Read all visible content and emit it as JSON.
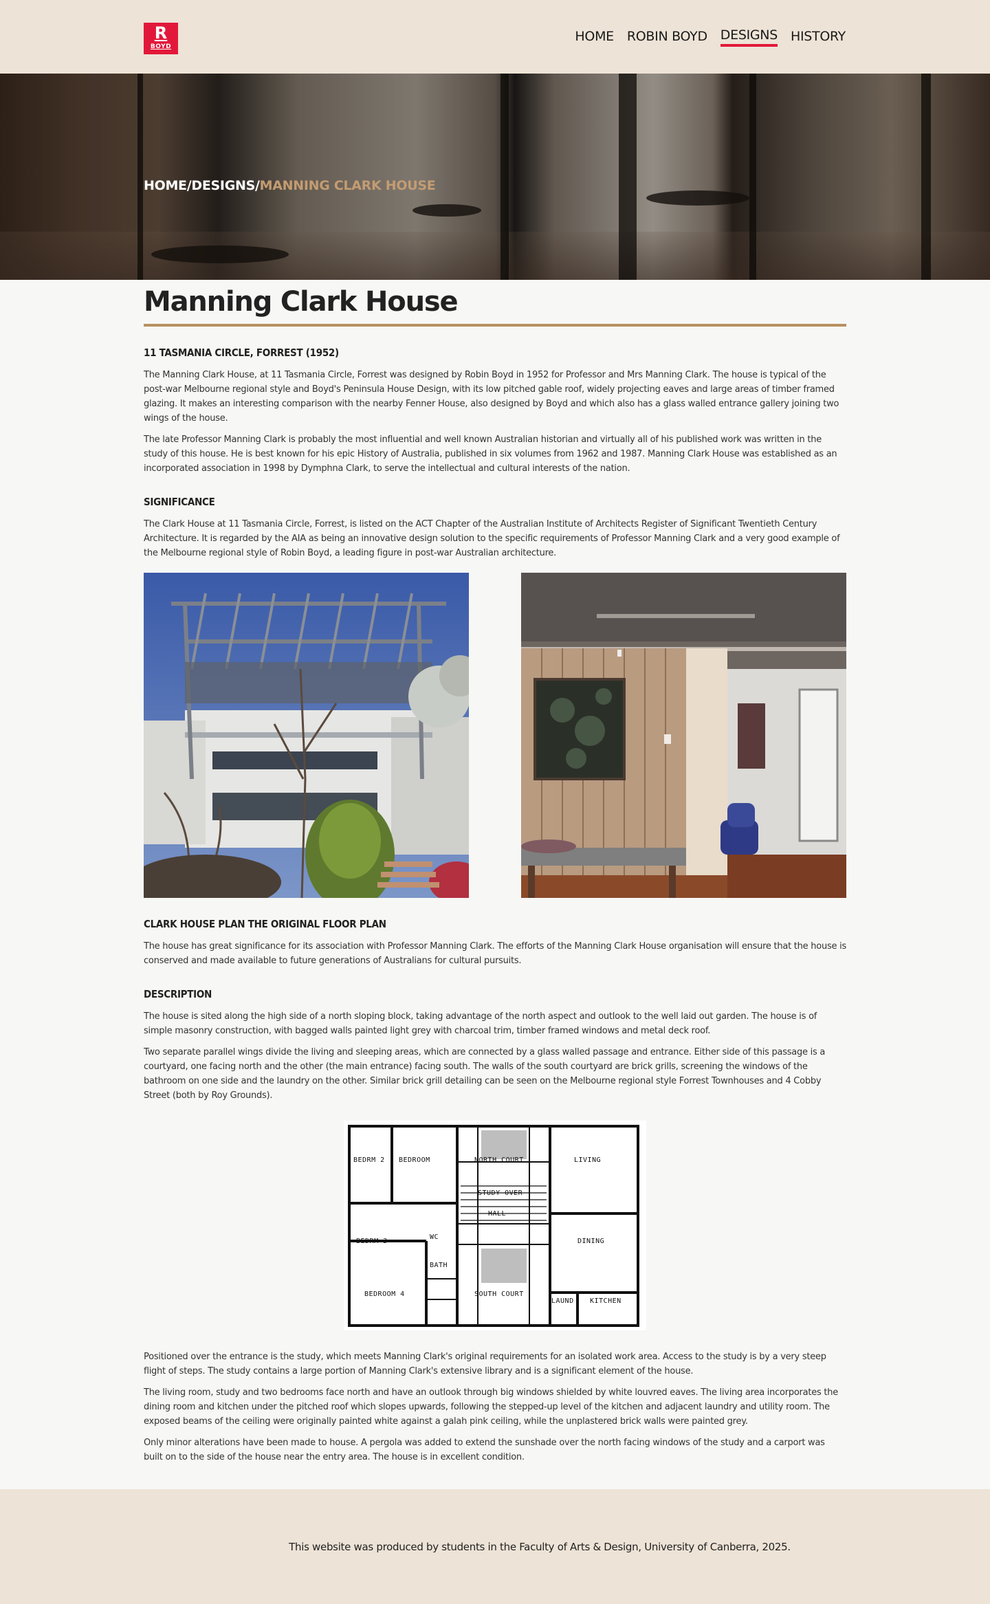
{
  "header": {
    "logo": {
      "letter": "R",
      "sub": "BOYD"
    },
    "nav": [
      {
        "label": "HOME"
      },
      {
        "label": "ROBIN BOYD"
      },
      {
        "label": "DESIGNS",
        "active": true
      },
      {
        "label": "HISTORY"
      }
    ]
  },
  "hero": {
    "breadcrumb": {
      "home": "HOME",
      "sep1": "/",
      "designs": "DESIGNS",
      "sep2": "/",
      "current": "MANNING CLARK HOUSE"
    }
  },
  "page": {
    "title": "Manning Clark House",
    "address_heading": "11 TASMANIA CIRCLE, FORREST (1952)",
    "intro_paragraphs": [
      "The Manning Clark House, at 11 Tasmania Circle, Forrest was designed by Robin Boyd in 1952 for Professor and Mrs Manning Clark. The house is typical of the post-war Melbourne regional style and Boyd's Peninsula House Design, with its low pitched gable roof, widely projecting eaves and large areas of timber framed glazing. It makes an interesting comparison with the nearby Fenner House, also designed by Boyd and which also has a glass walled entrance gallery joining two wings of the house.",
      "The late Professor Manning Clark is probably the most influential and well known Australian historian and virtually all of his published work was written in the study of this house. He is best known for his epic History of Australia, published in six volumes from 1962 and 1987. Manning Clark House was established as an incorporated association in 1998 by Dymphna Clark, to serve the intellectual and cultural interests of the nation."
    ],
    "significance_heading": "SIGNIFICANCE",
    "significance_text": "The Clark House at 11 Tasmania Circle, Forrest, is listed on the ACT Chapter of the Australian Institute of Architects Register of Significant Twentieth Century Architecture. It is regarded by the AIA as being an innovative design solution to the specific requirements of Professor Manning Clark and a very good example of the Melbourne regional style of Robin Boyd, a leading figure in post-war Australian architecture.",
    "plan_heading": "CLARK HOUSE PLAN THE ORIGINAL FLOOR PLAN",
    "plan_text": "The house has great significance for its association with Professor Manning Clark. The efforts of the Manning Clark House organisation will ensure that the house is conserved and made available to future generations of Australians for cultural pursuits.",
    "description_heading": "DESCRIPTION",
    "description_paragraphs": [
      "The house is sited along the high side of a north sloping block, taking advantage of the north aspect and outlook to the well laid out garden. The house is of simple masonry construction, with bagged walls painted light grey with charcoal trim, timber framed windows and metal deck roof.",
      "Two separate parallel wings divide the living and sleeping areas, which are connected by a glass walled passage and entrance. Either side of this passage is a courtyard, one facing north and the other (the main entrance) facing south. The walls of the south courtyard are brick grills, screening the windows of the bathroom on one side and the laundry on the other. Similar brick grill detailing can be seen on the Melbourne regional style Forrest Townhouses and 4 Cobby Street (both by Roy Grounds)."
    ],
    "floor_plan_labels": {
      "bedrm2": "BEDRM 2",
      "bedroom": "BEDROOM",
      "north_court": "NORTH COURT",
      "living": "LIVING",
      "study_over": "STUDY OVER",
      "hall": "HALL",
      "bedrm3": "BEDRM 3",
      "dining": "DINING",
      "bath": "BATH",
      "wc": "WC",
      "bedroom4": "BEDROOM 4",
      "south_court": "SOUTH COURT",
      "laund": "LAUND",
      "kitchen": "KITCHEN"
    },
    "closing_paragraphs": [
      "Positioned over the entrance is the study, which meets Manning Clark's original requirements for an isolated work area. Access to the study is by a very steep flight of steps. The study contains a large portion of Manning Clark's extensive library and is a significant element of the house.",
      "The living room, study and two bedrooms face north and have an outlook through big windows shielded by white louvred eaves. The living area incorporates the dining room and kitchen under the pitched roof which slopes upwards, following the stepped-up level of the kitchen and adjacent laundry and utility room. The exposed beams of the ceiling were originally painted white against a galah pink ceiling, while the unplastered brick walls were painted grey.",
      "Only minor alterations have been made to house. A pergola was added to extend the sunshade over the north facing windows of the study and a carport was built on to the side of the house near the entry area. The house is in excellent condition."
    ]
  },
  "footer": {
    "text": "This website was produced by students in the Faculty of Arts & Design, University of Canberra, 2025."
  },
  "colors": {
    "brand_red": "#e2183a",
    "accent_gold": "#b9905f",
    "header_bg": "#ede3d6",
    "page_bg": "#f7f7f6"
  }
}
